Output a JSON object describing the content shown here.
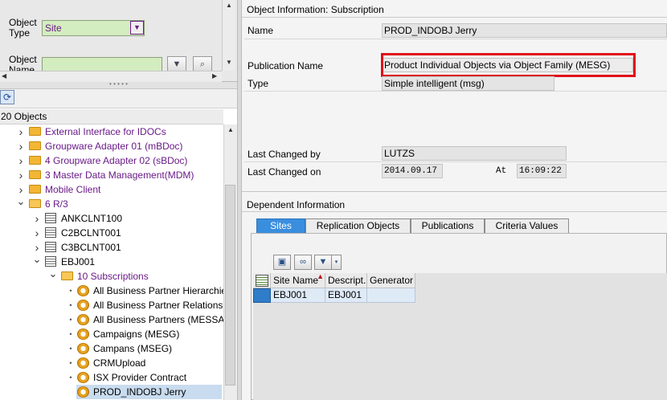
{
  "search": {
    "object_type_label": "Object\nType",
    "object_type_value": "Site",
    "object_name_label": "Object\nName"
  },
  "tree": {
    "header": "20 Objects",
    "rows": [
      {
        "label": "External Interface for IDOCs",
        "kind": "folder",
        "expander": "collapsed",
        "level": 0,
        "color": "purple"
      },
      {
        "label": "Groupware Adapter 01 (mBDoc)",
        "kind": "folder",
        "expander": "collapsed",
        "level": 0,
        "color": "purple"
      },
      {
        "label": "4 Groupware Adapter 02 (sBDoc)",
        "kind": "folder",
        "expander": "collapsed",
        "level": 0,
        "color": "purple"
      },
      {
        "label": "3 Master Data Management(MDM)",
        "kind": "folder",
        "expander": "collapsed",
        "level": 0,
        "color": "purple"
      },
      {
        "label": "Mobile Client",
        "kind": "folder",
        "expander": "collapsed",
        "level": 0,
        "color": "purple"
      },
      {
        "label": "6 R/3",
        "kind": "folder-open",
        "expander": "expanded",
        "level": 0,
        "color": "purple"
      },
      {
        "label": "ANKCLNT100",
        "kind": "system",
        "expander": "collapsed",
        "level": 1,
        "color": "black"
      },
      {
        "label": "C2BCLNT001",
        "kind": "system",
        "expander": "collapsed",
        "level": 1,
        "color": "black"
      },
      {
        "label": "C3BCLNT001",
        "kind": "system",
        "expander": "collapsed",
        "level": 1,
        "color": "black"
      },
      {
        "label": "EBJ001",
        "kind": "system",
        "expander": "expanded",
        "level": 1,
        "color": "black"
      },
      {
        "label": "10 Subscriptions",
        "kind": "folder-open",
        "expander": "expanded",
        "level": 2,
        "color": "purple"
      },
      {
        "label": "All Business Partner Hierarchies",
        "kind": "subscription",
        "expander": "leaf",
        "level": 3,
        "color": "black"
      },
      {
        "label": "All Business Partner Relationships",
        "kind": "subscription",
        "expander": "leaf",
        "level": 3,
        "color": "black"
      },
      {
        "label": "All Business Partners (MESSAGE",
        "kind": "subscription",
        "expander": "leaf",
        "level": 3,
        "color": "black"
      },
      {
        "label": "Campaigns (MESG)",
        "kind": "subscription",
        "expander": "leaf",
        "level": 3,
        "color": "black"
      },
      {
        "label": "Campans (MSEG)",
        "kind": "subscription",
        "expander": "leaf",
        "level": 3,
        "color": "black"
      },
      {
        "label": "CRMUpload",
        "kind": "subscription",
        "expander": "leaf",
        "level": 3,
        "color": "black"
      },
      {
        "label": "ISX Provider Contract",
        "kind": "subscription",
        "expander": "leaf",
        "level": 3,
        "color": "black"
      },
      {
        "label": "PROD_INDOBJ Jerry",
        "kind": "subscription",
        "expander": "leaf",
        "level": 3,
        "color": "black",
        "selected": true
      }
    ]
  },
  "object_info": {
    "title": "Object Information: Subscription",
    "name_label": "Name",
    "name_value": "PROD_INDOBJ Jerry",
    "publication_label": "Publication Name",
    "publication_value": "Product Individual Objects via Object Family (MESG)",
    "type_label": "Type",
    "type_value": "Simple intelligent (msg)",
    "last_changed_by_label": "Last Changed by",
    "last_changed_by_value": "LUTZS",
    "last_changed_on_label": "Last Changed on",
    "last_changed_on_value": "2014.09.17",
    "at_label": "At",
    "at_value": "16:09:22"
  },
  "dependent": {
    "title": "Dependent Information",
    "tabs": [
      "Sites",
      "Replication Objects",
      "Publications",
      "Criteria Values"
    ],
    "active_tab": "Sites",
    "columns": [
      "Site Name",
      "Descript.",
      "Generator"
    ],
    "rows": [
      {
        "site_name": "EBJ001",
        "description": "EBJ001",
        "generator": ""
      }
    ]
  },
  "colors": {
    "highlight_border": "#e0101a",
    "active_tab": "#3a8ede",
    "input_green": "#d4edc0",
    "purple_text": "#6a1a88"
  }
}
